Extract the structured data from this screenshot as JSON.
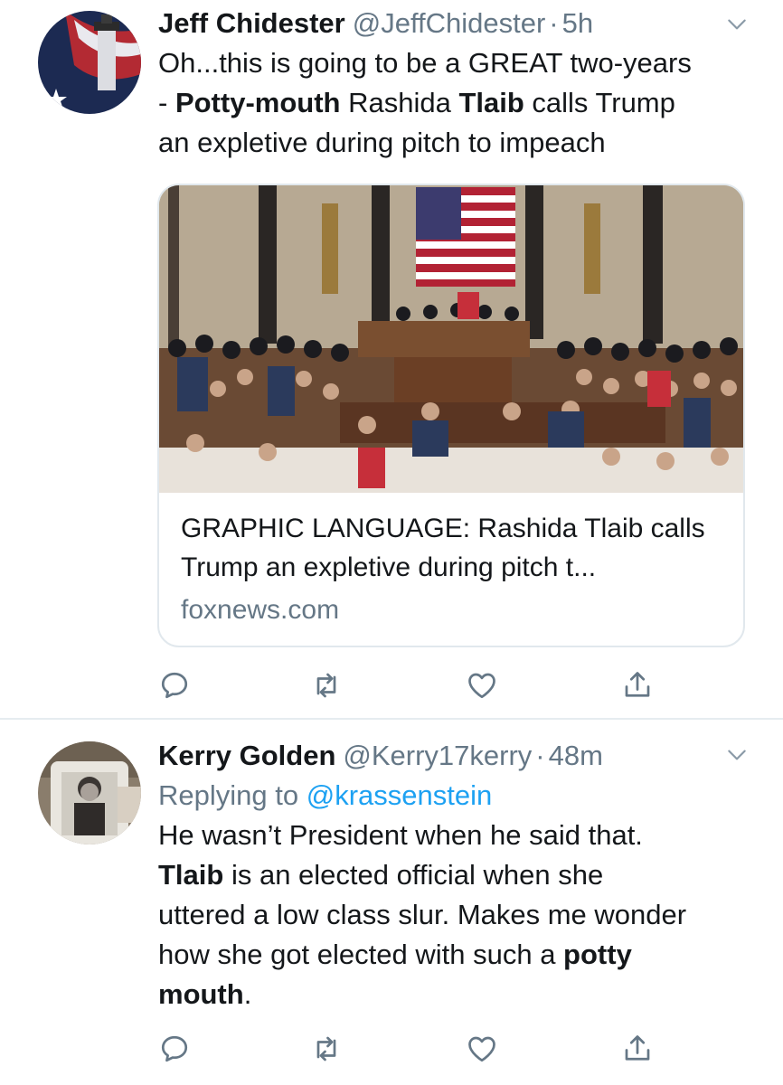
{
  "tweets": [
    {
      "name": "Jeff Chidester",
      "handle": "@JeffChidester",
      "separator": "·",
      "time": "5h",
      "text": {
        "l1": "Oh...this is going to be a GREAT two-years",
        "l2_a": "- ",
        "l2_b": "Potty-mouth",
        "l2_c": " Rashida ",
        "l2_d": "Tlaib",
        "l2_e": " calls Trump",
        "l3": "an expletive during pitch to impeach"
      },
      "card": {
        "title": "GRAPHIC LANGUAGE: Rashida Tlaib calls Trump an expletive during pitch t...",
        "domain": "foxnews.com"
      }
    },
    {
      "name": "Kerry Golden",
      "handle": "@Kerry17kerry",
      "separator": "·",
      "time": "48m",
      "replying_prefix": "Replying to ",
      "replying_to": "@krassenstein",
      "text": {
        "l1": "He wasn’t President when he said that.",
        "l2_a": "Tlaib",
        "l2_b": " is an elected official when she",
        "l3": "uttered a low class slur.  Makes me wonder",
        "l4_a": "how she got elected with such a ",
        "l4_b": "potty",
        "l5": "mouth",
        "l5_end": "."
      }
    }
  ],
  "icons": {
    "reply": "reply-icon",
    "retweet": "retweet-icon",
    "like": "heart-icon",
    "share": "share-icon",
    "more": "chevron-down-icon"
  },
  "colors": {
    "text": "#14171a",
    "muted": "#657786",
    "link": "#1da1f2",
    "border": "#e1e8ed"
  }
}
